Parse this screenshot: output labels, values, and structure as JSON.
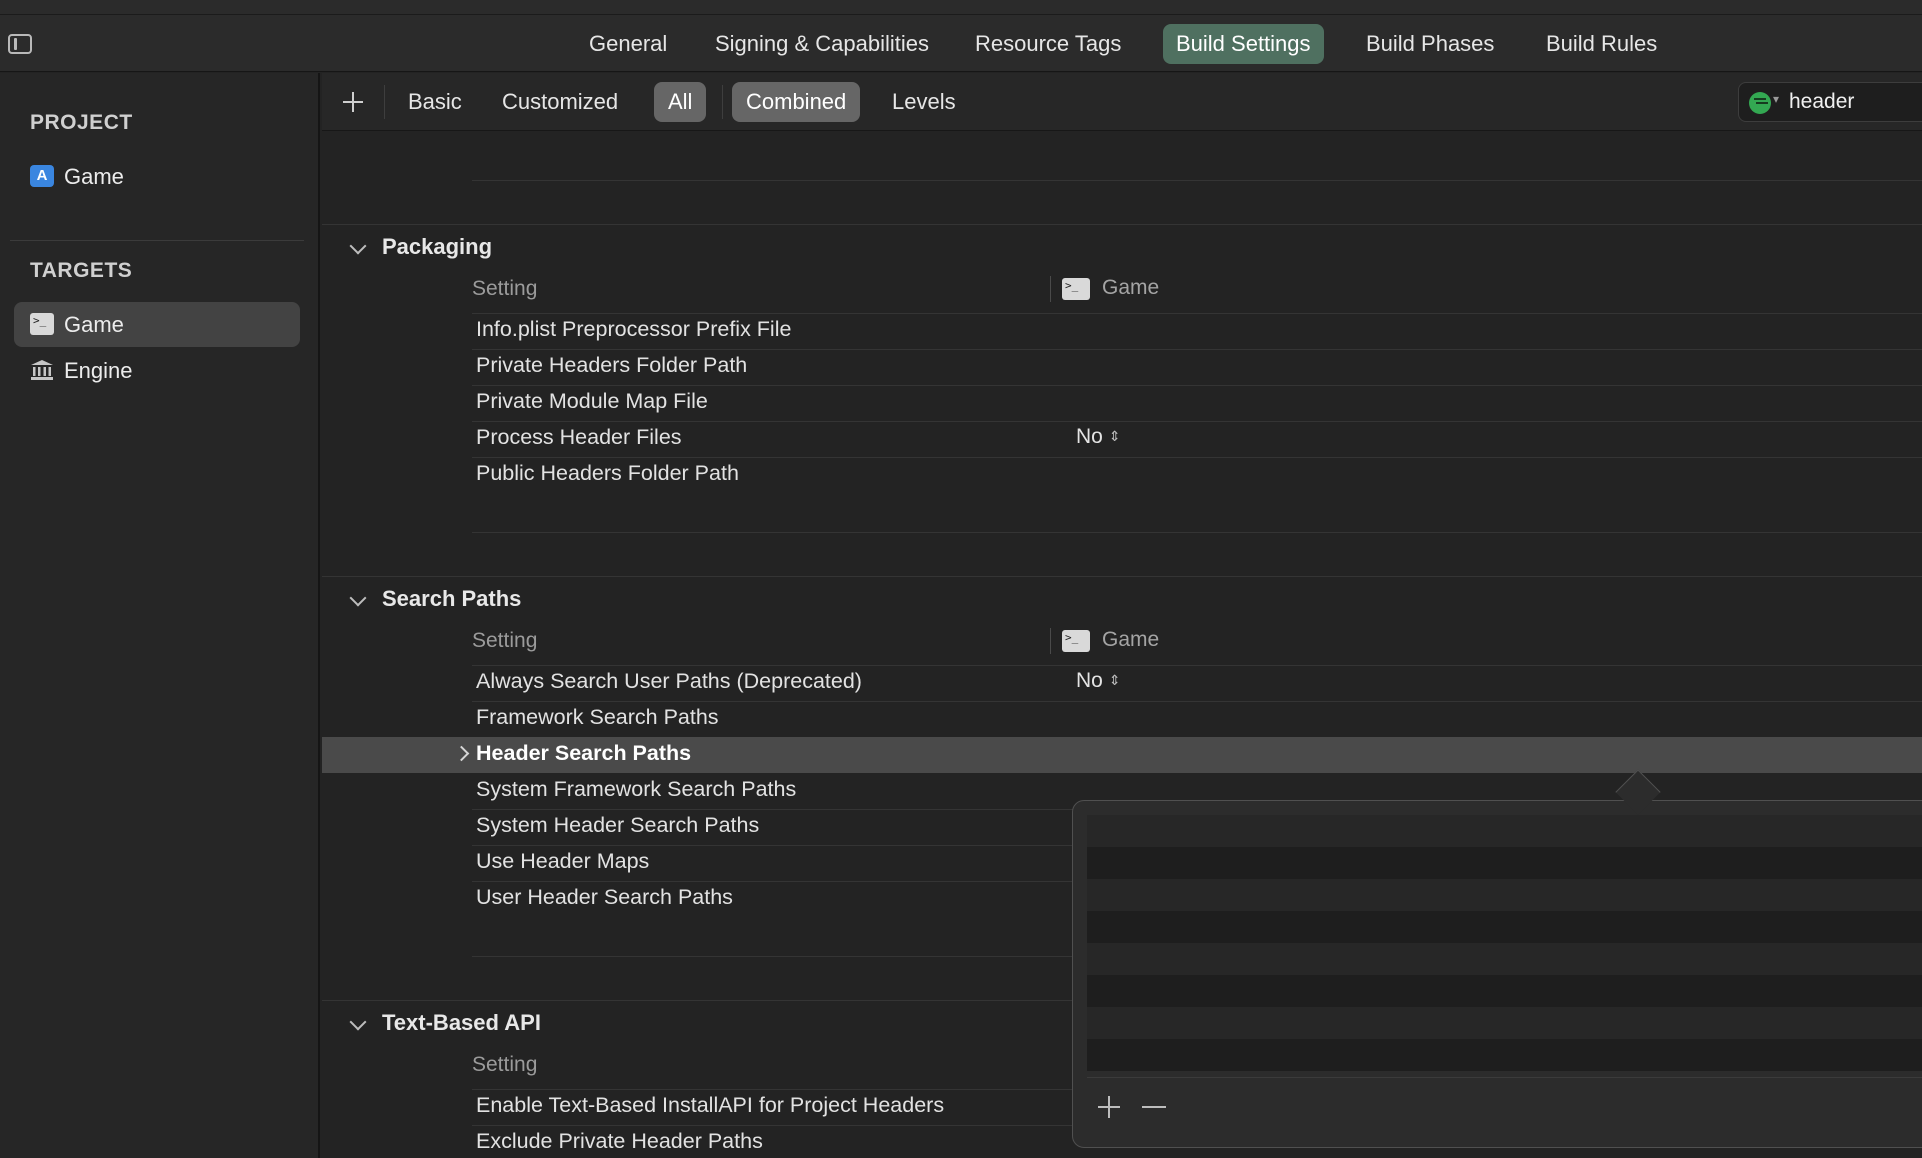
{
  "tabs": [
    "General",
    "Signing & Capabilities",
    "Resource Tags",
    "Build Settings",
    "Build Phases",
    "Build Rules"
  ],
  "active_tab": "Build Settings",
  "sidebar": {
    "project_heading": "PROJECT",
    "project_items": [
      {
        "label": "Game",
        "icon": "app-project-icon"
      }
    ],
    "targets_heading": "TARGETS",
    "target_items": [
      {
        "label": "Game",
        "icon": "terminal-icon",
        "selected": true
      },
      {
        "label": "Engine",
        "icon": "library-icon",
        "selected": false
      }
    ]
  },
  "filter": {
    "segments": [
      "Basic",
      "Customized",
      "All",
      "Combined",
      "Levels"
    ],
    "active_segments": [
      "All",
      "Combined"
    ],
    "search_value": "header"
  },
  "sections": [
    {
      "title": "Packaging",
      "col_setting": "Setting",
      "col_target": "Game",
      "rows": [
        {
          "name": "Info.plist Preprocessor Prefix File",
          "value": ""
        },
        {
          "name": "Private Headers Folder Path",
          "value": ""
        },
        {
          "name": "Private Module Map File",
          "value": ""
        },
        {
          "name": "Process Header Files",
          "value": "No"
        },
        {
          "name": "Public Headers Folder Path",
          "value": ""
        }
      ]
    },
    {
      "title": "Search Paths",
      "col_setting": "Setting",
      "col_target": "Game",
      "rows": [
        {
          "name": "Always Search User Paths (Deprecated)",
          "value": "No"
        },
        {
          "name": "Framework Search Paths",
          "value": ""
        },
        {
          "name": "Header Search Paths",
          "value": "",
          "selected": true
        },
        {
          "name": "System Framework Search Paths",
          "value": ""
        },
        {
          "name": "System Header Search Paths",
          "value": ""
        },
        {
          "name": "Use Header Maps",
          "value": ""
        },
        {
          "name": "User Header Search Paths",
          "value": ""
        }
      ]
    },
    {
      "title": "Text-Based API",
      "col_setting": "Setting",
      "rows": [
        {
          "name": "Enable Text-Based InstallAPI for Project Headers",
          "value": ""
        },
        {
          "name": "Exclude Private Header Paths",
          "value": ""
        }
      ]
    }
  ],
  "colors": {
    "active_tab_bg": "#4f7060",
    "filter_icon": "#33a852",
    "selected_row_bg": "#4a4a4a"
  }
}
